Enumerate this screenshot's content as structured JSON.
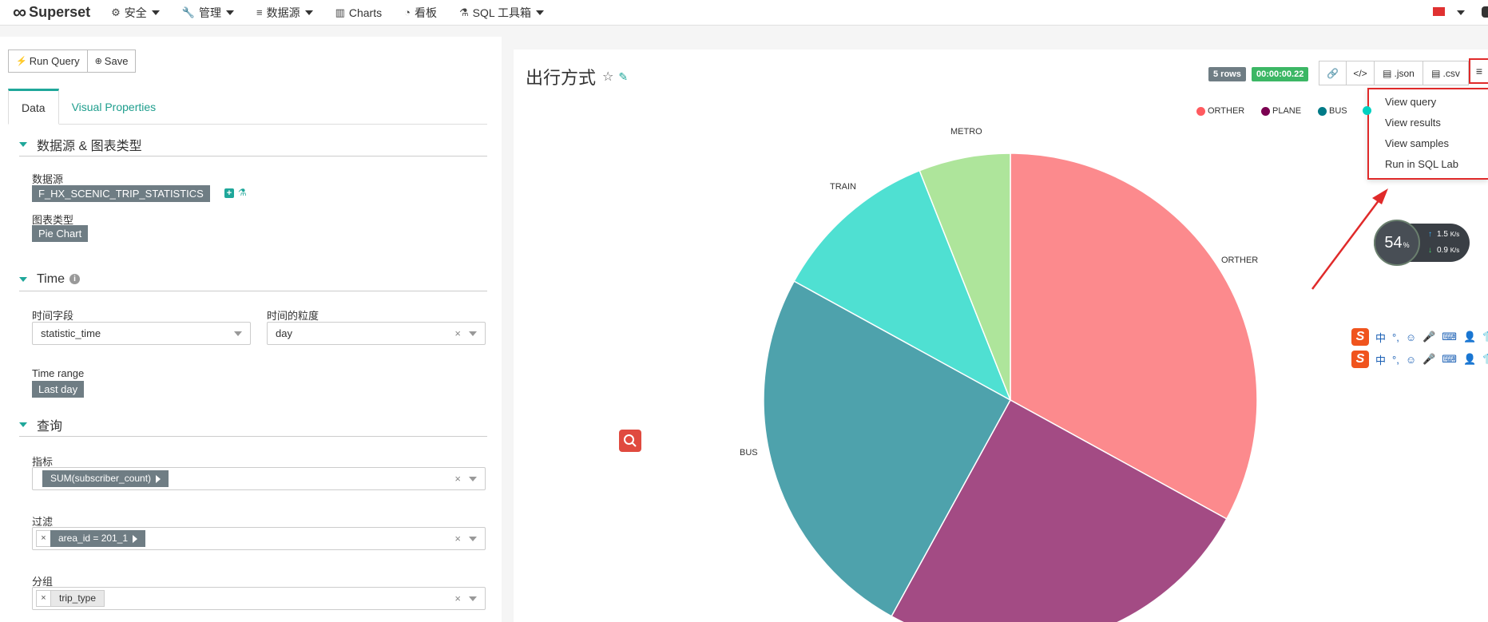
{
  "nav": {
    "brand": "Superset",
    "items": [
      {
        "icon": "gears-icon",
        "glyph": "⚙",
        "label": "安全",
        "dropdown": true
      },
      {
        "icon": "wrench-icon",
        "glyph": "🔧",
        "label": "管理",
        "dropdown": true
      },
      {
        "icon": "database-icon",
        "glyph": "≡",
        "label": "数据源",
        "dropdown": true
      },
      {
        "icon": "bar-chart-icon",
        "glyph": "▥",
        "label": "Charts",
        "dropdown": false
      },
      {
        "icon": "dashboard-icon",
        "glyph": "◔",
        "label": "看板",
        "dropdown": false
      },
      {
        "icon": "flask-icon",
        "glyph": "⚗",
        "label": "SQL 工具箱",
        "dropdown": true
      }
    ]
  },
  "toolbar": {
    "run_query": "Run Query",
    "save": "Save"
  },
  "tabs": [
    "Data",
    "Visual Properties"
  ],
  "sections": {
    "datasource": {
      "title": "数据源 & 图表类型",
      "datasource_label": "数据源",
      "datasource_value": "F_HX_SCENIC_TRIP_STATISTICS",
      "viz_label": "图表类型",
      "viz_value": "Pie Chart"
    },
    "time": {
      "title": "Time",
      "time_column_label": "时间字段",
      "time_column_value": "statistic_time",
      "grain_label": "时间的粒度",
      "grain_value": "day",
      "range_label": "Time range",
      "range_value": "Last day"
    },
    "query": {
      "title": "查询",
      "metrics_label": "指标",
      "metrics_value": "SUM(subscriber_count)",
      "filters_label": "过滤",
      "filters_value": "area_id = 201_1",
      "groupby_label": "分组",
      "groupby_value": "trip_type"
    }
  },
  "chart_header": {
    "title": "出行方式",
    "rows_badge": "5 rows",
    "time_badge": "00:00:00.22",
    "json_label": ".json",
    "csv_label": ".csv",
    "code_label": "</>"
  },
  "menu": {
    "items": [
      "View query",
      "View results",
      "View samples",
      "Run in SQL Lab"
    ]
  },
  "chart_data": {
    "type": "pie",
    "categories": [
      "ORTHER",
      "PLANE",
      "BUS",
      "TRAIN",
      "METRO"
    ],
    "values": [
      33,
      25,
      25,
      11,
      6
    ],
    "colors": [
      "#fc8a8d",
      "#a34b84",
      "#4ea2ac",
      "#4fe0d2",
      "#aee59b"
    ],
    "legend_visible": [
      "ORTHER",
      "PLANE",
      "BUS"
    ],
    "legend_colors": [
      "#ff5a5f",
      "#7b0051",
      "#007a87",
      "#00d1c1"
    ],
    "legend_position": "top-right"
  },
  "speed_widget": {
    "percent": "54",
    "percent_unit": "%",
    "up": "1.5",
    "down": "0.9",
    "unit": "K/s"
  },
  "ime_bar": {
    "logo": "S",
    "lang": "中"
  }
}
